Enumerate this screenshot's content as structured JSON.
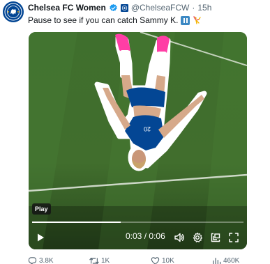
{
  "tweet": {
    "display_name": "Chelsea FC Women",
    "handle": "@ChelseaFCW",
    "separator": "·",
    "time": "15h",
    "text": "Pause to see if you can catch Sammy K.",
    "avatar": "chelsea-crest"
  },
  "video": {
    "tooltip": "Play",
    "current_time": "0:03",
    "duration": "0:06",
    "time_separator": "/",
    "progress_percent": 42,
    "player_number": "20"
  },
  "actions": {
    "replies": "3.8K",
    "reposts": "1K",
    "likes": "10K",
    "views": "460K"
  },
  "colors": {
    "verified": "#1d9bf0",
    "chelsea_blue": "#034694",
    "pitch": "#3f6e2c",
    "boots": "#ff3ea5"
  }
}
